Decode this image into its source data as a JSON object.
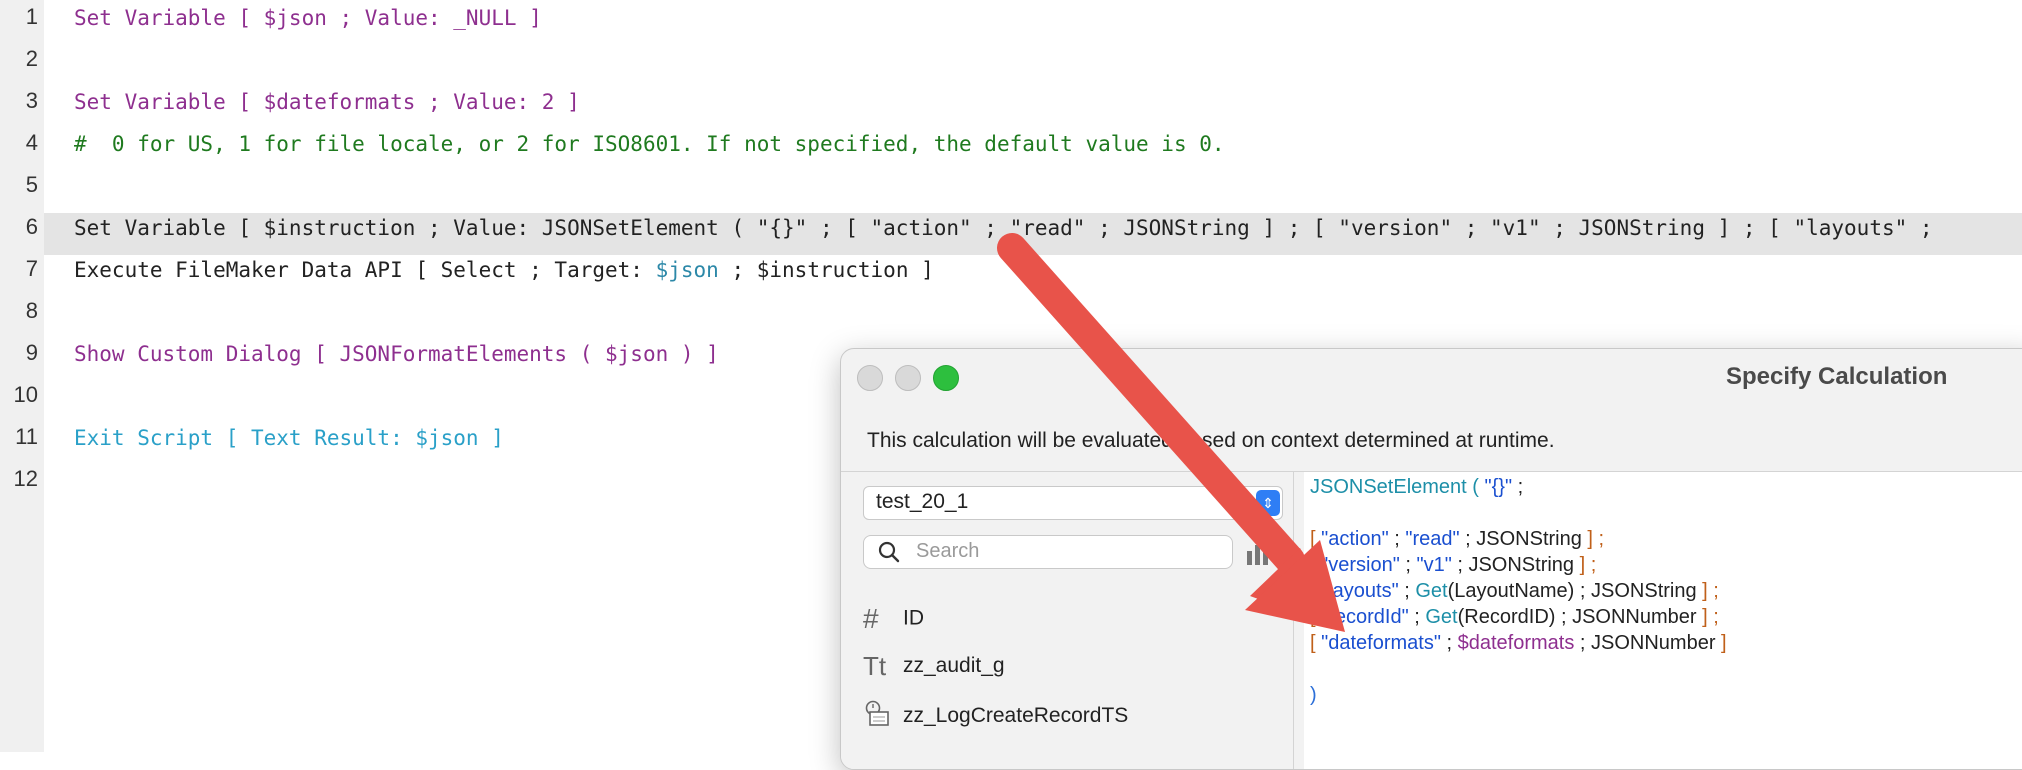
{
  "line_numbers": [
    "1",
    "2",
    "3",
    "4",
    "5",
    "6",
    "7",
    "8",
    "9",
    "10",
    "11",
    "12"
  ],
  "script": {
    "l1": "Set Variable [ $json ; Value: _NULL ]",
    "l3": "Set Variable [ $dateformats ; Value: 2 ]",
    "l4": "#  0 for US, 1 for file locale, or 2 for ISO8601. If not specified, the default value is 0.",
    "l6": "Set Variable [ $instruction ; Value: JSONSetElement ( \"{}\" ; [ \"action\" ; \"read\" ; JSONString ] ; [ \"version\" ; \"v1\" ; JSONString ] ; [ \"layouts\" ;",
    "l7_pre": "Execute FileMaker Data API [ Select ; Target: ",
    "l7_var": "$json",
    "l7_post": " ; $instruction ]",
    "l9": "Show Custom Dialog [ JSONFormatElements ( $json ) ]",
    "l11": "Exit Script [ Text Result: $json ]"
  },
  "dialog": {
    "title": "Specify Calculation",
    "description": "This calculation will be evaluated based on context determined at runtime.",
    "table_select": "test_20_1",
    "search_placeholder": "Search",
    "fields": [
      {
        "icon": "#",
        "name": "ID"
      },
      {
        "icon": "Tt",
        "name": "zz_audit_g"
      },
      {
        "icon": "timestamp",
        "name": "zz_LogCreateRecordTS"
      }
    ],
    "code": {
      "c1a": "JSONSetElement ( ",
      "c1b": "\"{}\"",
      "c1c": " ;",
      "c3a": "[ ",
      "c3b": "\"action\"",
      "c3c": " ; ",
      "c3d": "\"read\"",
      "c3e": " ; JSONString ",
      "c3f": "] ;",
      "c4a": "[ ",
      "c4b": "\"version\"",
      "c4c": " ; ",
      "c4d": "\"v1\"",
      "c4e": " ; JSONString ",
      "c4f": "] ;",
      "c5a": "[ ",
      "c5b": "\"layouts\"",
      "c5c": " ; ",
      "c5d": "Get",
      "c5e": "(LayoutName)",
      "c5f": " ; JSONString ",
      "c5g": "] ;",
      "c6a": "[ ",
      "c6b": "\"recordId\"",
      "c6c": " ; ",
      "c6d": "Get",
      "c6e": "(RecordID)",
      "c6f": " ; JSONNumber ",
      "c6g": "] ;",
      "c7a": "[ ",
      "c7b": "\"dateformats\"",
      "c7c": " ; ",
      "c7d": "$dateformats",
      "c7e": " ; JSONNumber ",
      "c7f": "]",
      "c9": ")"
    }
  },
  "colors": {
    "accent_arrow": "#e8534a",
    "script_step": "#8e2f8f",
    "comment": "#1f7a1f"
  }
}
